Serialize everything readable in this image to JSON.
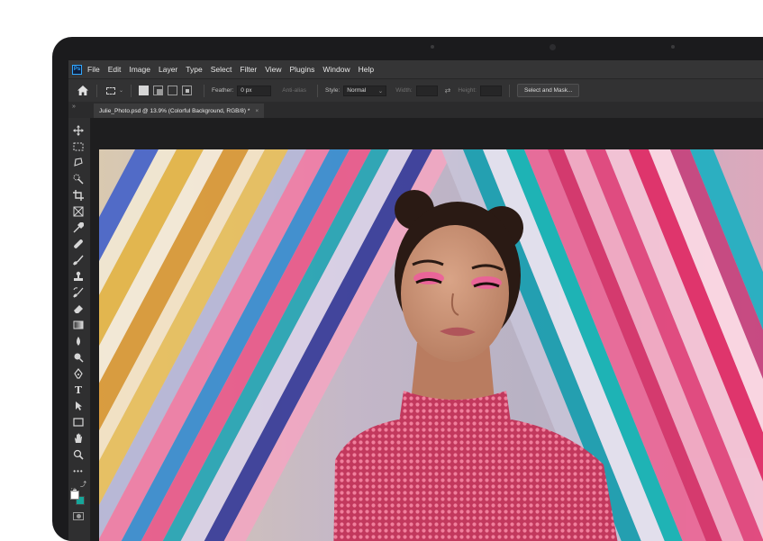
{
  "menubar": {
    "app_icon": "Ps",
    "items": [
      "File",
      "Edit",
      "Image",
      "Layer",
      "Type",
      "Select",
      "Filter",
      "View",
      "Plugins",
      "Window",
      "Help"
    ]
  },
  "options": {
    "feather_label": "Feather:",
    "feather_value": "0 px",
    "antialias_label": "Anti-alias",
    "style_label": "Style:",
    "style_value": "Normal",
    "width_label": "Width:",
    "height_label": "Height:",
    "select_mask_label": "Select and Mask..."
  },
  "document": {
    "tab_title": "Julie_Photo.psd @ 13.9% (Colorful Background, RGB/8) *",
    "close_glyph": "×",
    "collapse_glyph": "»"
  },
  "tools": [
    "move-icon",
    "marquee-icon",
    "lasso-icon",
    "quick-select-icon",
    "crop-icon",
    "frame-icon",
    "eyedropper-icon",
    "healing-icon",
    "brush-icon",
    "stamp-icon",
    "history-brush-icon",
    "eraser-icon",
    "gradient-icon",
    "blur-icon",
    "dodge-icon",
    "pen-icon",
    "type-icon",
    "path-select-icon",
    "rectangle-icon",
    "hand-icon",
    "zoom-icon",
    "more-icon"
  ],
  "colors": {
    "foreground": "#ffffff",
    "background": "#17a69a",
    "ui_dark": "#252526",
    "accent": "#31a8ff"
  }
}
